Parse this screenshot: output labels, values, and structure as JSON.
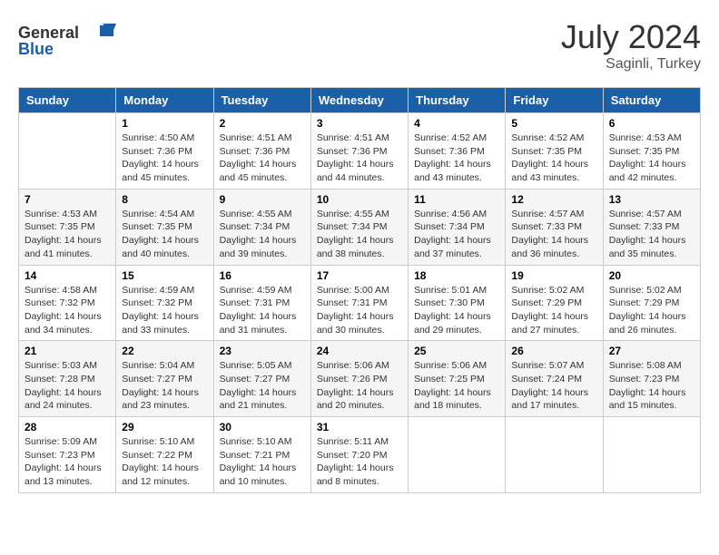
{
  "header": {
    "logo_general": "General",
    "logo_blue": "Blue",
    "month": "July 2024",
    "location": "Saginli, Turkey"
  },
  "weekdays": [
    "Sunday",
    "Monday",
    "Tuesday",
    "Wednesday",
    "Thursday",
    "Friday",
    "Saturday"
  ],
  "weeks": [
    [
      {
        "day": "",
        "sunrise": "",
        "sunset": "",
        "daylight": ""
      },
      {
        "day": "1",
        "sunrise": "Sunrise: 4:50 AM",
        "sunset": "Sunset: 7:36 PM",
        "daylight": "Daylight: 14 hours and 45 minutes."
      },
      {
        "day": "2",
        "sunrise": "Sunrise: 4:51 AM",
        "sunset": "Sunset: 7:36 PM",
        "daylight": "Daylight: 14 hours and 45 minutes."
      },
      {
        "day": "3",
        "sunrise": "Sunrise: 4:51 AM",
        "sunset": "Sunset: 7:36 PM",
        "daylight": "Daylight: 14 hours and 44 minutes."
      },
      {
        "day": "4",
        "sunrise": "Sunrise: 4:52 AM",
        "sunset": "Sunset: 7:36 PM",
        "daylight": "Daylight: 14 hours and 43 minutes."
      },
      {
        "day": "5",
        "sunrise": "Sunrise: 4:52 AM",
        "sunset": "Sunset: 7:35 PM",
        "daylight": "Daylight: 14 hours and 43 minutes."
      },
      {
        "day": "6",
        "sunrise": "Sunrise: 4:53 AM",
        "sunset": "Sunset: 7:35 PM",
        "daylight": "Daylight: 14 hours and 42 minutes."
      }
    ],
    [
      {
        "day": "7",
        "sunrise": "Sunrise: 4:53 AM",
        "sunset": "Sunset: 7:35 PM",
        "daylight": "Daylight: 14 hours and 41 minutes."
      },
      {
        "day": "8",
        "sunrise": "Sunrise: 4:54 AM",
        "sunset": "Sunset: 7:35 PM",
        "daylight": "Daylight: 14 hours and 40 minutes."
      },
      {
        "day": "9",
        "sunrise": "Sunrise: 4:55 AM",
        "sunset": "Sunset: 7:34 PM",
        "daylight": "Daylight: 14 hours and 39 minutes."
      },
      {
        "day": "10",
        "sunrise": "Sunrise: 4:55 AM",
        "sunset": "Sunset: 7:34 PM",
        "daylight": "Daylight: 14 hours and 38 minutes."
      },
      {
        "day": "11",
        "sunrise": "Sunrise: 4:56 AM",
        "sunset": "Sunset: 7:34 PM",
        "daylight": "Daylight: 14 hours and 37 minutes."
      },
      {
        "day": "12",
        "sunrise": "Sunrise: 4:57 AM",
        "sunset": "Sunset: 7:33 PM",
        "daylight": "Daylight: 14 hours and 36 minutes."
      },
      {
        "day": "13",
        "sunrise": "Sunrise: 4:57 AM",
        "sunset": "Sunset: 7:33 PM",
        "daylight": "Daylight: 14 hours and 35 minutes."
      }
    ],
    [
      {
        "day": "14",
        "sunrise": "Sunrise: 4:58 AM",
        "sunset": "Sunset: 7:32 PM",
        "daylight": "Daylight: 14 hours and 34 minutes."
      },
      {
        "day": "15",
        "sunrise": "Sunrise: 4:59 AM",
        "sunset": "Sunset: 7:32 PM",
        "daylight": "Daylight: 14 hours and 33 minutes."
      },
      {
        "day": "16",
        "sunrise": "Sunrise: 4:59 AM",
        "sunset": "Sunset: 7:31 PM",
        "daylight": "Daylight: 14 hours and 31 minutes."
      },
      {
        "day": "17",
        "sunrise": "Sunrise: 5:00 AM",
        "sunset": "Sunset: 7:31 PM",
        "daylight": "Daylight: 14 hours and 30 minutes."
      },
      {
        "day": "18",
        "sunrise": "Sunrise: 5:01 AM",
        "sunset": "Sunset: 7:30 PM",
        "daylight": "Daylight: 14 hours and 29 minutes."
      },
      {
        "day": "19",
        "sunrise": "Sunrise: 5:02 AM",
        "sunset": "Sunset: 7:29 PM",
        "daylight": "Daylight: 14 hours and 27 minutes."
      },
      {
        "day": "20",
        "sunrise": "Sunrise: 5:02 AM",
        "sunset": "Sunset: 7:29 PM",
        "daylight": "Daylight: 14 hours and 26 minutes."
      }
    ],
    [
      {
        "day": "21",
        "sunrise": "Sunrise: 5:03 AM",
        "sunset": "Sunset: 7:28 PM",
        "daylight": "Daylight: 14 hours and 24 minutes."
      },
      {
        "day": "22",
        "sunrise": "Sunrise: 5:04 AM",
        "sunset": "Sunset: 7:27 PM",
        "daylight": "Daylight: 14 hours and 23 minutes."
      },
      {
        "day": "23",
        "sunrise": "Sunrise: 5:05 AM",
        "sunset": "Sunset: 7:27 PM",
        "daylight": "Daylight: 14 hours and 21 minutes."
      },
      {
        "day": "24",
        "sunrise": "Sunrise: 5:06 AM",
        "sunset": "Sunset: 7:26 PM",
        "daylight": "Daylight: 14 hours and 20 minutes."
      },
      {
        "day": "25",
        "sunrise": "Sunrise: 5:06 AM",
        "sunset": "Sunset: 7:25 PM",
        "daylight": "Daylight: 14 hours and 18 minutes."
      },
      {
        "day": "26",
        "sunrise": "Sunrise: 5:07 AM",
        "sunset": "Sunset: 7:24 PM",
        "daylight": "Daylight: 14 hours and 17 minutes."
      },
      {
        "day": "27",
        "sunrise": "Sunrise: 5:08 AM",
        "sunset": "Sunset: 7:23 PM",
        "daylight": "Daylight: 14 hours and 15 minutes."
      }
    ],
    [
      {
        "day": "28",
        "sunrise": "Sunrise: 5:09 AM",
        "sunset": "Sunset: 7:23 PM",
        "daylight": "Daylight: 14 hours and 13 minutes."
      },
      {
        "day": "29",
        "sunrise": "Sunrise: 5:10 AM",
        "sunset": "Sunset: 7:22 PM",
        "daylight": "Daylight: 14 hours and 12 minutes."
      },
      {
        "day": "30",
        "sunrise": "Sunrise: 5:10 AM",
        "sunset": "Sunset: 7:21 PM",
        "daylight": "Daylight: 14 hours and 10 minutes."
      },
      {
        "day": "31",
        "sunrise": "Sunrise: 5:11 AM",
        "sunset": "Sunset: 7:20 PM",
        "daylight": "Daylight: 14 hours and 8 minutes."
      },
      {
        "day": "",
        "sunrise": "",
        "sunset": "",
        "daylight": ""
      },
      {
        "day": "",
        "sunrise": "",
        "sunset": "",
        "daylight": ""
      },
      {
        "day": "",
        "sunrise": "",
        "sunset": "",
        "daylight": ""
      }
    ]
  ]
}
